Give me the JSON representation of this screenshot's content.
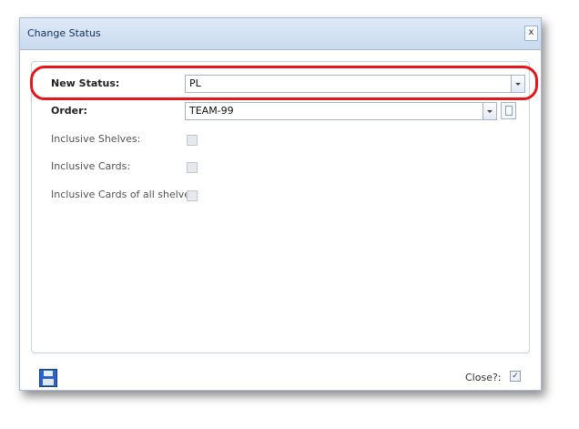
{
  "dialog": {
    "title": "Change Status",
    "close_label": "x"
  },
  "form": {
    "new_status": {
      "label": "New Status:",
      "value": "PL"
    },
    "order": {
      "label": "Order:",
      "value": "TEAM-99"
    },
    "inclusive_shelves": {
      "label": "Inclusive Shelves:",
      "checked": false
    },
    "inclusive_cards": {
      "label": "Inclusive Cards:",
      "checked": false
    },
    "inclusive_cards_all": {
      "label": "Inclusive Cards of all shelves:",
      "checked": false
    }
  },
  "footer": {
    "close_label": "Close?:",
    "close_checked": true,
    "close_check_glyph": "✓"
  },
  "colors": {
    "highlight": "#e5171d",
    "titlebar": "#c9daef"
  }
}
